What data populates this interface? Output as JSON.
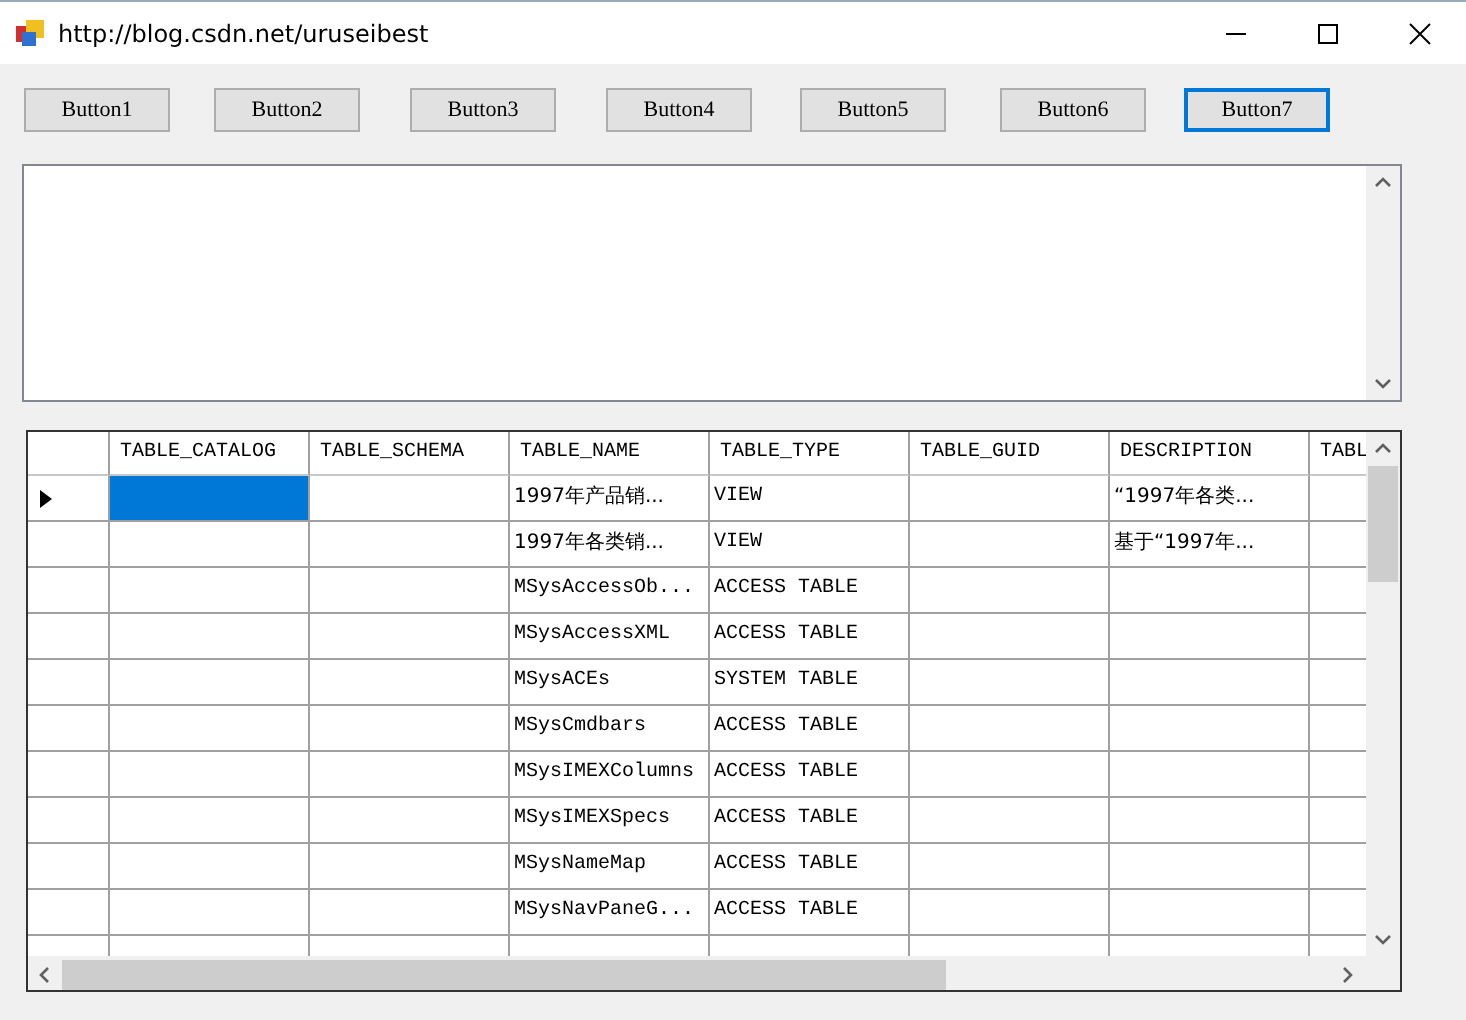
{
  "window": {
    "title": "http://blog.csdn.net/uruseibest"
  },
  "buttons": [
    {
      "label": "Button1",
      "focused": false
    },
    {
      "label": "Button2",
      "focused": false
    },
    {
      "label": "Button3",
      "focused": false
    },
    {
      "label": "Button4",
      "focused": false
    },
    {
      "label": "Button5",
      "focused": false
    },
    {
      "label": "Button6",
      "focused": false
    },
    {
      "label": "Button7",
      "focused": true
    }
  ],
  "grid": {
    "columns": [
      "TABLE_CATALOG",
      "TABLE_SCHEMA",
      "TABLE_NAME",
      "TABLE_TYPE",
      "TABLE_GUID",
      "DESCRIPTION",
      "TABL"
    ],
    "rows": [
      {
        "current": true,
        "cells": [
          {
            "selected": true
          },
          {
            "selected": false
          },
          {
            "text": "1997年产品销...",
            "selected": false
          },
          {
            "text": "VIEW",
            "selected": false
          },
          {
            "selected": false
          },
          {
            "text": "“1997年各类...",
            "selected": false
          },
          {
            "selected": false
          }
        ]
      },
      {
        "current": false,
        "cells": [
          {
            "selected": false
          },
          {
            "selected": false
          },
          {
            "text": "1997年各类销...",
            "selected": false
          },
          {
            "text": "VIEW",
            "selected": false
          },
          {
            "selected": false
          },
          {
            "text": "基于“1997年...",
            "selected": false
          },
          {
            "selected": false
          }
        ]
      },
      {
        "current": false,
        "cells": [
          {
            "selected": false
          },
          {
            "selected": false
          },
          {
            "text": "MSysAccessOb...",
            "selected": false
          },
          {
            "text": "ACCESS TABLE",
            "selected": false
          },
          {
            "selected": false
          },
          {
            "selected": false
          },
          {
            "selected": false
          }
        ]
      },
      {
        "current": false,
        "cells": [
          {
            "selected": false
          },
          {
            "selected": false
          },
          {
            "text": "MSysAccessXML",
            "selected": false
          },
          {
            "text": "ACCESS TABLE",
            "selected": false
          },
          {
            "selected": false
          },
          {
            "selected": false
          },
          {
            "selected": false
          }
        ]
      },
      {
        "current": false,
        "cells": [
          {
            "selected": false
          },
          {
            "selected": false
          },
          {
            "text": "MSysACEs",
            "selected": false
          },
          {
            "text": "SYSTEM TABLE",
            "selected": false
          },
          {
            "selected": false
          },
          {
            "selected": false
          },
          {
            "selected": false
          }
        ]
      },
      {
        "current": false,
        "cells": [
          {
            "selected": false
          },
          {
            "selected": false
          },
          {
            "text": "MSysCmdbars",
            "selected": false
          },
          {
            "text": "ACCESS TABLE",
            "selected": false
          },
          {
            "selected": false
          },
          {
            "selected": false
          },
          {
            "selected": false
          }
        ]
      },
      {
        "current": false,
        "cells": [
          {
            "selected": false
          },
          {
            "selected": false
          },
          {
            "text": "MSysIMEXColumns",
            "selected": false
          },
          {
            "text": "ACCESS TABLE",
            "selected": false
          },
          {
            "selected": false
          },
          {
            "selected": false
          },
          {
            "selected": false
          }
        ]
      },
      {
        "current": false,
        "cells": [
          {
            "selected": false
          },
          {
            "selected": false
          },
          {
            "text": "MSysIMEXSpecs",
            "selected": false
          },
          {
            "text": "ACCESS TABLE",
            "selected": false
          },
          {
            "selected": false
          },
          {
            "selected": false
          },
          {
            "selected": false
          }
        ]
      },
      {
        "current": false,
        "cells": [
          {
            "selected": false
          },
          {
            "selected": false
          },
          {
            "text": "MSysNameMap",
            "selected": false
          },
          {
            "text": "ACCESS TABLE",
            "selected": false
          },
          {
            "selected": false
          },
          {
            "selected": false
          },
          {
            "selected": false
          }
        ]
      },
      {
        "current": false,
        "cells": [
          {
            "selected": false
          },
          {
            "selected": false
          },
          {
            "text": "MSysNavPaneG...",
            "selected": false
          },
          {
            "text": "ACCESS TABLE",
            "selected": false
          },
          {
            "selected": false
          },
          {
            "selected": false
          },
          {
            "selected": false
          }
        ]
      },
      {
        "current": false,
        "cells": [
          {
            "selected": false
          },
          {
            "selected": false
          },
          {
            "selected": false
          },
          {
            "selected": false
          },
          {
            "selected": false
          },
          {
            "selected": false
          },
          {
            "selected": false
          }
        ]
      }
    ]
  }
}
